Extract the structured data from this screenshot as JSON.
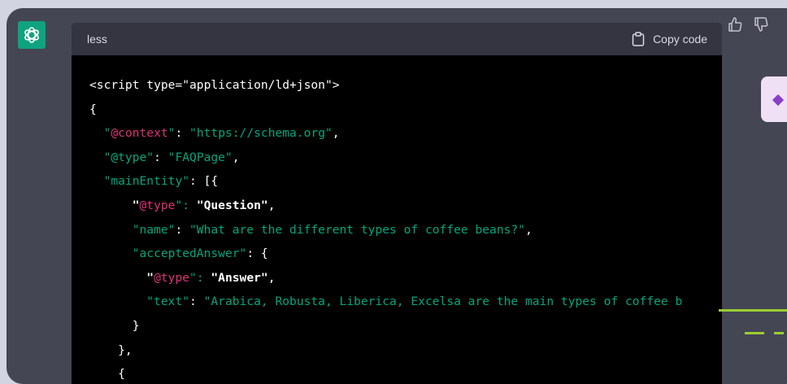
{
  "code_block": {
    "language": "less",
    "copy_label": "Copy code"
  },
  "icons": {
    "avatar": "openai-logo-icon",
    "copy": "clipboard-icon",
    "thumbs_up": "thumbs-up-icon",
    "thumbs_down": "thumbs-down-icon"
  },
  "colors": {
    "avatar_bg": "#10a37f",
    "string": "#00a67d",
    "key": "#df3079",
    "code_bg": "#000000",
    "panel_bg": "#444654"
  },
  "code_lines": [
    [
      {
        "t": "<script type=\"application/ld+json\">",
        "c": "plain"
      }
    ],
    [
      {
        "t": "{",
        "c": "plain"
      }
    ],
    [
      {
        "t": "  ",
        "c": "plain"
      },
      {
        "t": "\"",
        "c": "str"
      },
      {
        "t": "@context",
        "c": "key"
      },
      {
        "t": "\"",
        "c": "str"
      },
      {
        "t": ": ",
        "c": "plain"
      },
      {
        "t": "\"https://schema.org\"",
        "c": "str"
      },
      {
        "t": ",",
        "c": "plain"
      }
    ],
    [
      {
        "t": "  ",
        "c": "plain"
      },
      {
        "t": "\"@type\"",
        "c": "str"
      },
      {
        "t": ": ",
        "c": "plain"
      },
      {
        "t": "\"FAQPage\"",
        "c": "str"
      },
      {
        "t": ",",
        "c": "plain"
      }
    ],
    [
      {
        "t": "  ",
        "c": "plain"
      },
      {
        "t": "\"mainEntity\"",
        "c": "str"
      },
      {
        "t": ": [{",
        "c": "plain"
      }
    ],
    [
      {
        "t": "      ",
        "c": "plain"
      },
      {
        "t": "\"",
        "c": "bold"
      },
      {
        "t": "@type",
        "c": "key"
      },
      {
        "t": "\": ",
        "c": "str"
      },
      {
        "t": "\"Question\"",
        "c": "bold"
      },
      {
        "t": ",",
        "c": "plain"
      }
    ],
    [
      {
        "t": "      ",
        "c": "plain"
      },
      {
        "t": "\"name\"",
        "c": "str"
      },
      {
        "t": ": ",
        "c": "plain"
      },
      {
        "t": "\"What are the different types of coffee beans?\"",
        "c": "str"
      },
      {
        "t": ",",
        "c": "plain"
      }
    ],
    [
      {
        "t": "      ",
        "c": "plain"
      },
      {
        "t": "\"acceptedAnswer\"",
        "c": "str"
      },
      {
        "t": ": {",
        "c": "plain"
      }
    ],
    [
      {
        "t": "        ",
        "c": "plain"
      },
      {
        "t": "\"",
        "c": "bold"
      },
      {
        "t": "@type",
        "c": "key"
      },
      {
        "t": "\": ",
        "c": "str"
      },
      {
        "t": "\"Answer\"",
        "c": "bold"
      },
      {
        "t": ",",
        "c": "plain"
      }
    ],
    [
      {
        "t": "        ",
        "c": "plain"
      },
      {
        "t": "\"text\"",
        "c": "str"
      },
      {
        "t": ": ",
        "c": "plain"
      },
      {
        "t": "\"Arabica, Robusta, Liberica, Excelsa are the main types of coffee b",
        "c": "str"
      }
    ],
    [
      {
        "t": "      }",
        "c": "plain"
      }
    ],
    [
      {
        "t": "    },",
        "c": "plain"
      }
    ],
    [
      {
        "t": "    {",
        "c": "plain"
      }
    ]
  ]
}
